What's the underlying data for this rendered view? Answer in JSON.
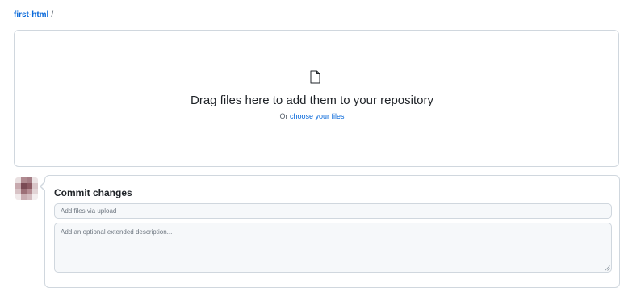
{
  "breadcrumb": {
    "repo": "first-html",
    "separator": "/"
  },
  "dropzone": {
    "icon": "file-icon",
    "title": "Drag files here to add them to your repository",
    "prefix": "Or",
    "choose_link": "choose your files"
  },
  "commit": {
    "title": "Commit changes",
    "summary_placeholder": "Add files via upload",
    "description_placeholder": "Add an optional extended description..."
  },
  "colors": {
    "link": "#0969da",
    "border": "#d0d7de",
    "input_bg": "#f6f8fa"
  }
}
